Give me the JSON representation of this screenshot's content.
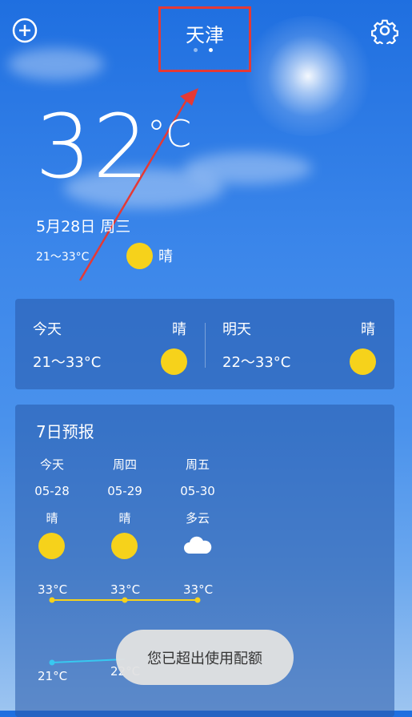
{
  "header": {
    "city": "天津"
  },
  "current": {
    "temp": "32",
    "unit": "°C",
    "date": "5月28日 周三",
    "range": "21～33°C",
    "condition": "晴"
  },
  "today_tomorrow": {
    "today": {
      "label": "今天",
      "condition": "晴",
      "range": "21～33°C"
    },
    "tomorrow": {
      "label": "明天",
      "condition": "晴",
      "range": "22～33°C"
    }
  },
  "forecast": {
    "title": "7日预报",
    "days": [
      {
        "day": "今天",
        "date": "05-28",
        "condition": "晴",
        "icon": "sun-icon",
        "high": "33°C",
        "low": "21°C"
      },
      {
        "day": "周四",
        "date": "05-29",
        "condition": "晴",
        "icon": "sun-icon",
        "high": "33°C",
        "low": "22°C"
      },
      {
        "day": "周五",
        "date": "05-30",
        "condition": "多云",
        "icon": "cloud-icon",
        "high": "33°C",
        "low": ""
      }
    ]
  },
  "toast": "您已超出使用配额",
  "colors": {
    "sun": "#f6d21b",
    "high_line": "#f6d21b",
    "low_line": "#38c8f0",
    "highlight": "#e53935"
  }
}
